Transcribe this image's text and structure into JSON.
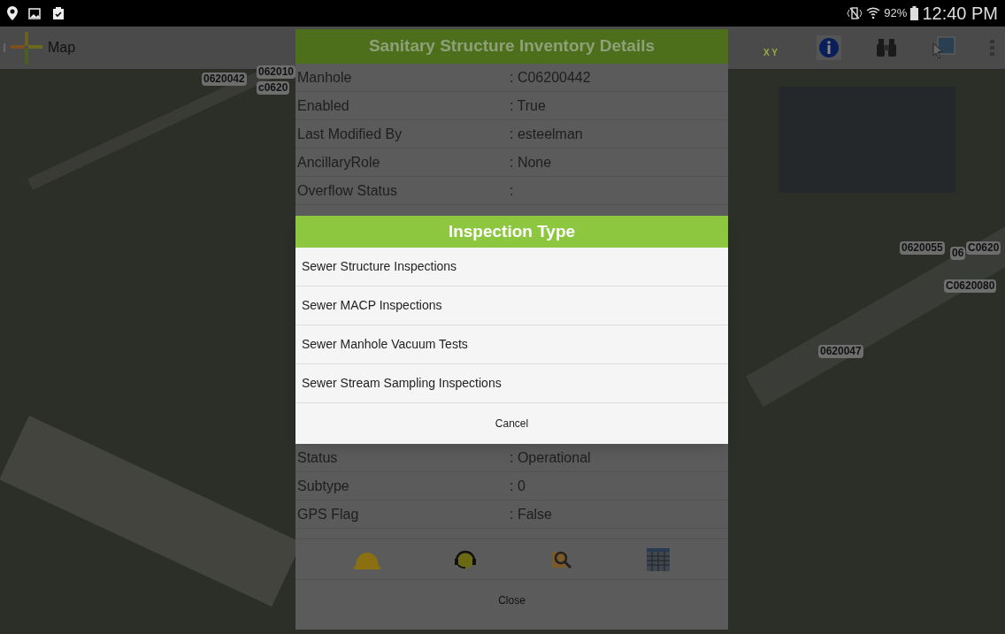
{
  "status_bar": {
    "battery": "92%",
    "time": "12:40 PM"
  },
  "app_bar": {
    "title": "Map",
    "xy_label": "X Y"
  },
  "map_labels": [
    "0620042",
    "062010",
    "c0620",
    "0620055",
    "06",
    "C0620",
    "C0620080",
    "0620047"
  ],
  "details_dialog": {
    "title": "Sanitary Structure Inventory Details",
    "rows_top": [
      {
        "label": "Manhole",
        "value": ": C06200442"
      },
      {
        "label": "Enabled",
        "value": ": True"
      },
      {
        "label": "Last Modified By",
        "value": ": esteelman"
      },
      {
        "label": "AncillaryRole",
        "value": ": None"
      },
      {
        "label": "Overflow Status",
        "value": ":"
      }
    ],
    "rows_bottom": [
      {
        "label": "Status",
        "value": ": Operational"
      },
      {
        "label": "Subtype",
        "value": ": 0"
      },
      {
        "label": "GPS Flag",
        "value": ": False"
      }
    ],
    "close": "Close"
  },
  "inspection_dialog": {
    "title": "Inspection Type",
    "items": [
      "Sewer Structure Inspections",
      "Sewer MACP Inspections",
      "Sewer Manhole Vacuum Tests",
      "Sewer Stream Sampling Inspections"
    ],
    "cancel": "Cancel"
  }
}
